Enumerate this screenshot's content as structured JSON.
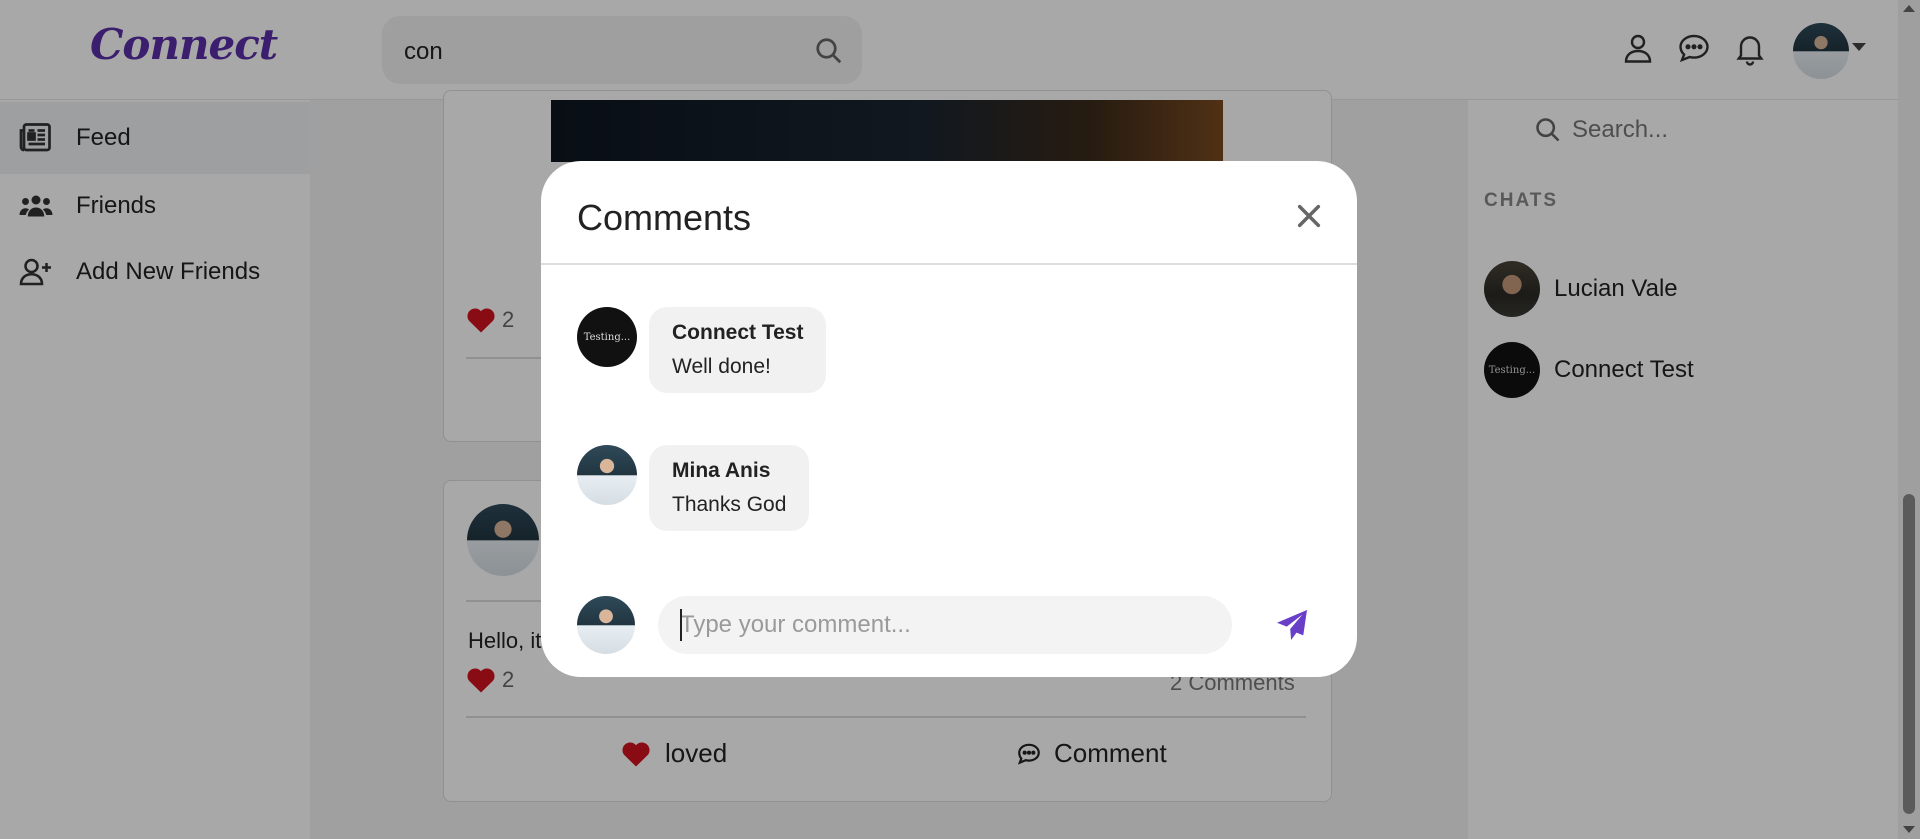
{
  "header": {
    "logo": "Connect",
    "search_value": "con"
  },
  "sidebar": {
    "items": [
      {
        "label": "Feed",
        "icon": "newspaper-icon",
        "active": true
      },
      {
        "label": "Friends",
        "icon": "users-icon",
        "active": false
      },
      {
        "label": "Add New Friends",
        "icon": "user-plus-icon",
        "active": false
      }
    ]
  },
  "feed": {
    "post1": {
      "love_count": "2"
    },
    "post2": {
      "text": "Hello, it",
      "love_count": "2",
      "comments_count": "2 Comments",
      "loved_label": "loved",
      "comment_label": "Comment"
    }
  },
  "rightbar": {
    "search_placeholder": "Search...",
    "chats_title": "CHATS",
    "chats": [
      {
        "name": "Lucian Vale"
      },
      {
        "name": "Connect Test"
      }
    ]
  },
  "modal": {
    "title": "Comments",
    "comments": [
      {
        "author": "Connect Test",
        "text": "Well done!",
        "avatar_text": "Testing..."
      },
      {
        "author": "Mina Anis",
        "text": "Thanks God"
      }
    ],
    "input_placeholder": "Type your comment..."
  },
  "colors": {
    "brand": "#5a2ea6",
    "heart": "#d0131f",
    "send": "#6a3fc8"
  }
}
